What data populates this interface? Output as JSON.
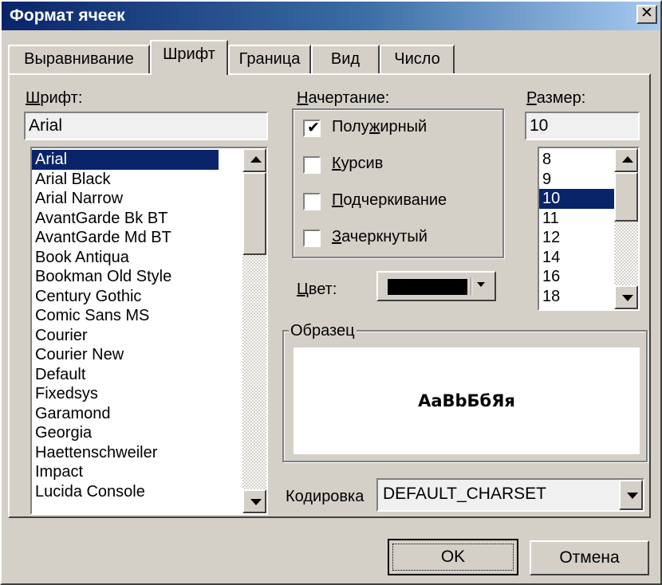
{
  "window": {
    "title": "Формат ячеек",
    "close_glyph": "✕"
  },
  "tabs": [
    {
      "label": "Выравнивание"
    },
    {
      "label": "Шрифт",
      "active": true
    },
    {
      "label": "Граница"
    },
    {
      "label": "Вид"
    },
    {
      "label": "Число"
    }
  ],
  "font": {
    "label_accel": "Ш",
    "label_rest": "рифт:",
    "value": "Arial",
    "items": [
      "Arial",
      "Arial Black",
      "Arial Narrow",
      "AvantGarde Bk BT",
      "AvantGarde Md BT",
      "Book Antiqua",
      "Bookman Old Style",
      "Century Gothic",
      "Comic Sans MS",
      "Courier",
      "Courier New",
      "Default",
      "Fixedsys",
      "Garamond",
      "Georgia",
      "Haettenschweiler",
      "Impact",
      "Lucida Console"
    ],
    "selected": "Arial"
  },
  "style": {
    "label_accel": "Н",
    "label_rest": "ачертание:",
    "options": [
      {
        "pre": "Полу",
        "accel": "ж",
        "post": "ирный",
        "checked": true
      },
      {
        "pre": "",
        "accel": "К",
        "post": "урсив",
        "checked": false
      },
      {
        "pre": "",
        "accel": "П",
        "post": "одчеркивание",
        "checked": false
      },
      {
        "pre": "",
        "accel": "З",
        "post": "ачеркнутый",
        "checked": false
      }
    ]
  },
  "size": {
    "label_accel": "Р",
    "label_rest": "азмер:",
    "value": "10",
    "items": [
      "8",
      "9",
      "10",
      "11",
      "12",
      "14",
      "16",
      "18"
    ],
    "selected": "10"
  },
  "color": {
    "label_accel": "Ц",
    "label_rest": "вет:",
    "value": "#000000"
  },
  "sample": {
    "label": "Образец",
    "text": "АаBbБбЯя"
  },
  "encoding": {
    "label_pre": "Ко",
    "label_accel": "д",
    "label_post": "ировка",
    "value": "DEFAULT_CHARSET"
  },
  "buttons": {
    "ok": "OK",
    "cancel": "Отмена"
  }
}
